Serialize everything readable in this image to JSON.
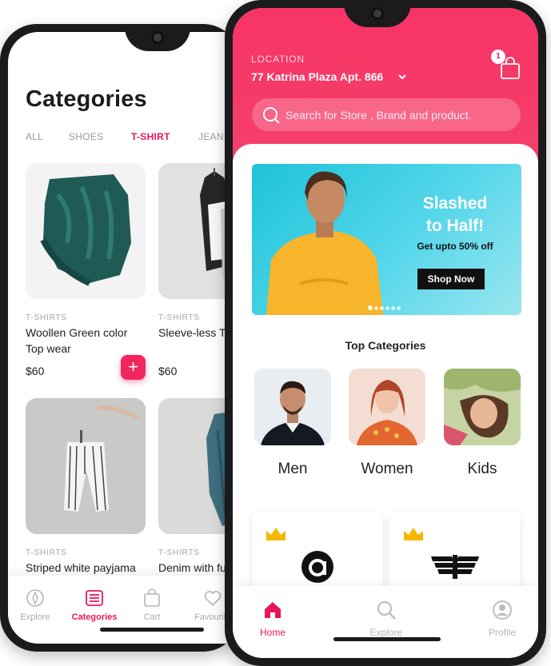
{
  "categories_screen": {
    "title": "Categories",
    "tabs": [
      {
        "label": "ALL"
      },
      {
        "label": "SHOES"
      },
      {
        "label": "T-SHIRT",
        "active": true
      },
      {
        "label": "JEANS"
      }
    ],
    "products": [
      {
        "category": "T-SHIRTS",
        "name_line1": "Woollen Green color",
        "name_line2": "Top wear",
        "price": "$60",
        "add_label": "+",
        "image_icon": "green-sweater-photo"
      },
      {
        "category": "T-SHIRTS",
        "name_line1": "Sleeve-less Te",
        "name_line2": "",
        "price": "$60",
        "image_icon": "hanging-tops-photo"
      },
      {
        "category": "T-SHIRTS",
        "name_line1": "Striped white payjama",
        "name_line2": "",
        "price": "",
        "image_icon": "striped-pants-photo"
      },
      {
        "category": "T-SHIRTS",
        "name_line1": "Denim with fu",
        "name_line2": "",
        "price": "",
        "image_icon": "denim-jacket-photo"
      }
    ],
    "bottom_nav": [
      {
        "label": "Explore",
        "icon": "compass-icon"
      },
      {
        "label": "Categories",
        "icon": "list-icon",
        "active": true
      },
      {
        "label": "Cart",
        "icon": "cart-icon"
      },
      {
        "label": "Favourite",
        "icon": "heart-icon"
      }
    ]
  },
  "home_screen": {
    "location_label": "LOCATION",
    "location_value": "77 Katrina Plaza Apt. 866",
    "cart_count": "1",
    "search_placeholder": "Search for Store , Brand and product.",
    "banner": {
      "headline_line1": "Slashed",
      "headline_line2": "to Half!",
      "subtext": "Get upto 50% off",
      "button_label": "Shop Now",
      "slide_count": 6,
      "active_slide": 1
    },
    "top_categories_title": "Top Categories",
    "top_categories": [
      {
        "label": "Men"
      },
      {
        "label": "Women"
      },
      {
        "label": "Kids"
      }
    ],
    "brands": [
      {
        "logo": "circle-a-logo"
      },
      {
        "logo": "eagle-logo"
      }
    ],
    "bottom_nav": [
      {
        "label": "Home",
        "icon": "home-icon",
        "active": true
      },
      {
        "label": "Explore",
        "icon": "search-icon"
      },
      {
        "label": "Profile",
        "icon": "user-icon"
      }
    ]
  },
  "colors": {
    "brand_pink": "#f2265f",
    "header_gradient_top": "#f73466",
    "banner_cyan": "#1ec3d8"
  }
}
